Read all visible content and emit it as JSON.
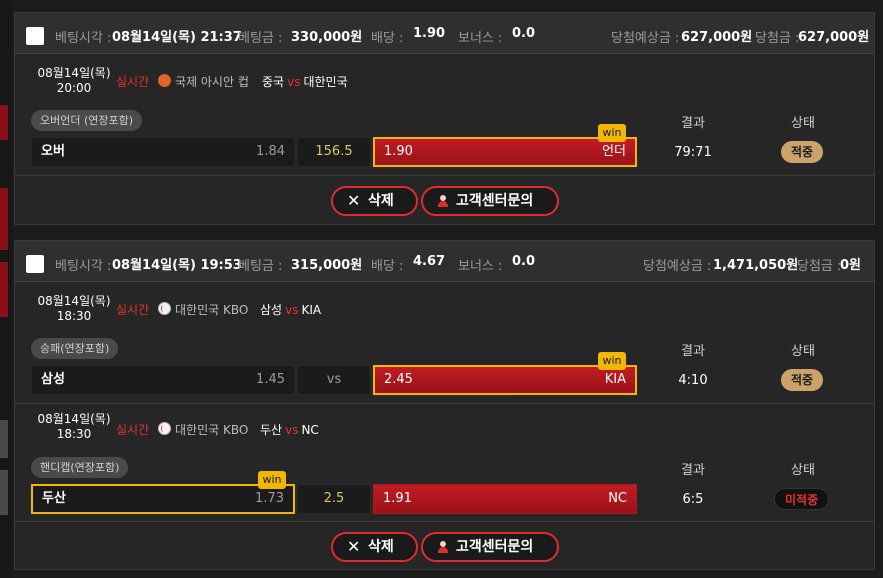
{
  "labels": {
    "bet_time": "베팅시각 :",
    "bet_amount": "베팅금 :",
    "odds": "배당 :",
    "bonus": "보너스 :",
    "expected_win": "당첨예상금 :",
    "win_amount": "당첨금 :",
    "result_header": "결과",
    "status_header": "상태",
    "live": "실시간",
    "vs": "vs",
    "win_badge": "win",
    "delete_button": "삭제",
    "support_button": "고객센터문의"
  },
  "icons": {
    "delete": "close-icon",
    "support": "agent-icon",
    "basketball": "basketball-icon",
    "baseball": "baseball-icon"
  },
  "colors": {
    "accent_red": "#e22a2f",
    "selected_border": "#f2b705",
    "status_ok": "#c9a36a",
    "status_pending_text": "#e8312f"
  },
  "bets": [
    {
      "bet_time": "08월14일(목) 21:37",
      "bet_amount": "330,000원",
      "odds": "1.90",
      "bonus": "0.0",
      "expected_win": "627,000원",
      "win_amount": "627,000원",
      "games": [
        {
          "date": "08월14일(목)",
          "time": "20:00",
          "sport_icon": "basketball-icon",
          "league": "국제 아시안 컵",
          "home_team": "중국",
          "away_team": "대한민국",
          "market": "오버언더 (연장포함)",
          "home_label": "오버",
          "home_odds": "1.84",
          "middle": "156.5",
          "away_label": "언더",
          "away_odds": "1.90",
          "result": "79:71",
          "status": "적중"
        }
      ]
    },
    {
      "bet_time": "08월14일(목) 19:53",
      "bet_amount": "315,000원",
      "odds": "4.67",
      "bonus": "0.0",
      "expected_win": "1,471,050원",
      "win_amount": "0원",
      "games": [
        {
          "date": "08월14일(목)",
          "time": "18:30",
          "sport_icon": "baseball-icon",
          "league": "대한민국 KBO",
          "home_team": "삼성",
          "away_team": "KIA",
          "market": "승패(연장포함)",
          "home_label": "삼성",
          "home_odds": "1.45",
          "middle": "vs",
          "away_label": "KIA",
          "away_odds": "2.45",
          "result": "4:10",
          "status": "적중"
        },
        {
          "date": "08월14일(목)",
          "time": "18:30",
          "sport_icon": "baseball-icon",
          "league": "대한민국 KBO",
          "home_team": "두산",
          "away_team": "NC",
          "market": "핸디캡(연장포함)",
          "home_label": "두산",
          "home_odds": "1.73",
          "middle": "2.5",
          "away_label": "NC",
          "away_odds": "1.91",
          "result": "6:5",
          "status": "미적중"
        }
      ]
    }
  ]
}
